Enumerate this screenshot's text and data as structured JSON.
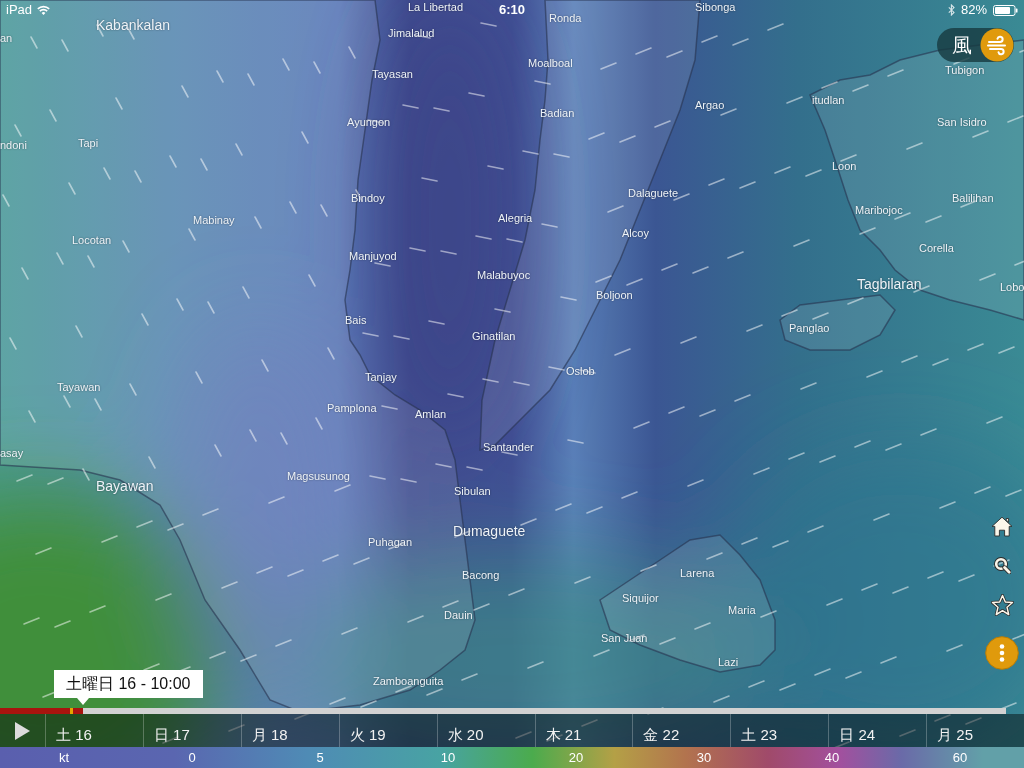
{
  "status_bar": {
    "device": "iPad",
    "time": "6:10",
    "battery": "82%"
  },
  "layer_switch": {
    "label": "風",
    "active": true
  },
  "map": {
    "labels": [
      {
        "text": "La Libertad",
        "kind": "town"
      },
      {
        "text": "an",
        "kind": "town"
      },
      {
        "text": "Kabankalan",
        "kind": "city"
      },
      {
        "text": "Jimalalud",
        "kind": "town"
      },
      {
        "text": "Ronda",
        "kind": "town"
      },
      {
        "text": "Sibonga",
        "kind": "town"
      },
      {
        "text": "Moalboal",
        "kind": "town"
      },
      {
        "text": "Tayasan",
        "kind": "town"
      },
      {
        "text": "Tubigon",
        "kind": "town"
      },
      {
        "text": "Argao",
        "kind": "town"
      },
      {
        "text": "itudlan",
        "kind": "town"
      },
      {
        "text": "Badian",
        "kind": "town"
      },
      {
        "text": "Ayungon",
        "kind": "town"
      },
      {
        "text": "San Isidro",
        "kind": "town"
      },
      {
        "text": "Tapi",
        "kind": "town"
      },
      {
        "text": "ndoni",
        "kind": "town"
      },
      {
        "text": "Loon",
        "kind": "town"
      },
      {
        "text": "Dalaguete",
        "kind": "town"
      },
      {
        "text": "Bindoy",
        "kind": "town"
      },
      {
        "text": "Balilihan",
        "kind": "town"
      },
      {
        "text": "Maribojoc",
        "kind": "town"
      },
      {
        "text": "Alegria",
        "kind": "town"
      },
      {
        "text": "Mabinay",
        "kind": "town"
      },
      {
        "text": "Alcoy",
        "kind": "town"
      },
      {
        "text": "Locotan",
        "kind": "town"
      },
      {
        "text": "Corella",
        "kind": "town"
      },
      {
        "text": "Manjuyod",
        "kind": "town"
      },
      {
        "text": "Malabuyoc",
        "kind": "town"
      },
      {
        "text": "Tagbilaran",
        "kind": "city"
      },
      {
        "text": "Lobo",
        "kind": "town"
      },
      {
        "text": "Boljoon",
        "kind": "town"
      },
      {
        "text": "Bais",
        "kind": "town"
      },
      {
        "text": "Panglao",
        "kind": "town"
      },
      {
        "text": "Ginatilan",
        "kind": "town"
      },
      {
        "text": "Oslob",
        "kind": "town"
      },
      {
        "text": "Tanjay",
        "kind": "town"
      },
      {
        "text": "Tayawan",
        "kind": "town"
      },
      {
        "text": "Pamplona",
        "kind": "town"
      },
      {
        "text": "Amlan",
        "kind": "town"
      },
      {
        "text": "Santander",
        "kind": "town"
      },
      {
        "text": "asay",
        "kind": "town"
      },
      {
        "text": "Magsusunog",
        "kind": "town"
      },
      {
        "text": "Bayawan",
        "kind": "city"
      },
      {
        "text": "Sibulan",
        "kind": "town"
      },
      {
        "text": "Dumaguete",
        "kind": "city"
      },
      {
        "text": "Puhagan",
        "kind": "town"
      },
      {
        "text": "Larena",
        "kind": "town"
      },
      {
        "text": "Bacong",
        "kind": "town"
      },
      {
        "text": "Siquijor",
        "kind": "town"
      },
      {
        "text": "Maria",
        "kind": "town"
      },
      {
        "text": "Dauin",
        "kind": "town"
      },
      {
        "text": "San Juan",
        "kind": "town"
      },
      {
        "text": "Lazi",
        "kind": "town"
      },
      {
        "text": "Zamboanguita",
        "kind": "town"
      }
    ]
  },
  "timeline": {
    "tooltip": "土曜日 16 - 10:00",
    "level": 0.083,
    "days": [
      "土 16",
      "日 17",
      "月 18",
      "火 19",
      "水 20",
      "木 21",
      "金 22",
      "土 23",
      "日 24",
      "月 25"
    ]
  },
  "legend": {
    "unit": "kt",
    "ticks": [
      "0",
      "5",
      "10",
      "20",
      "30",
      "40",
      "60"
    ]
  }
}
